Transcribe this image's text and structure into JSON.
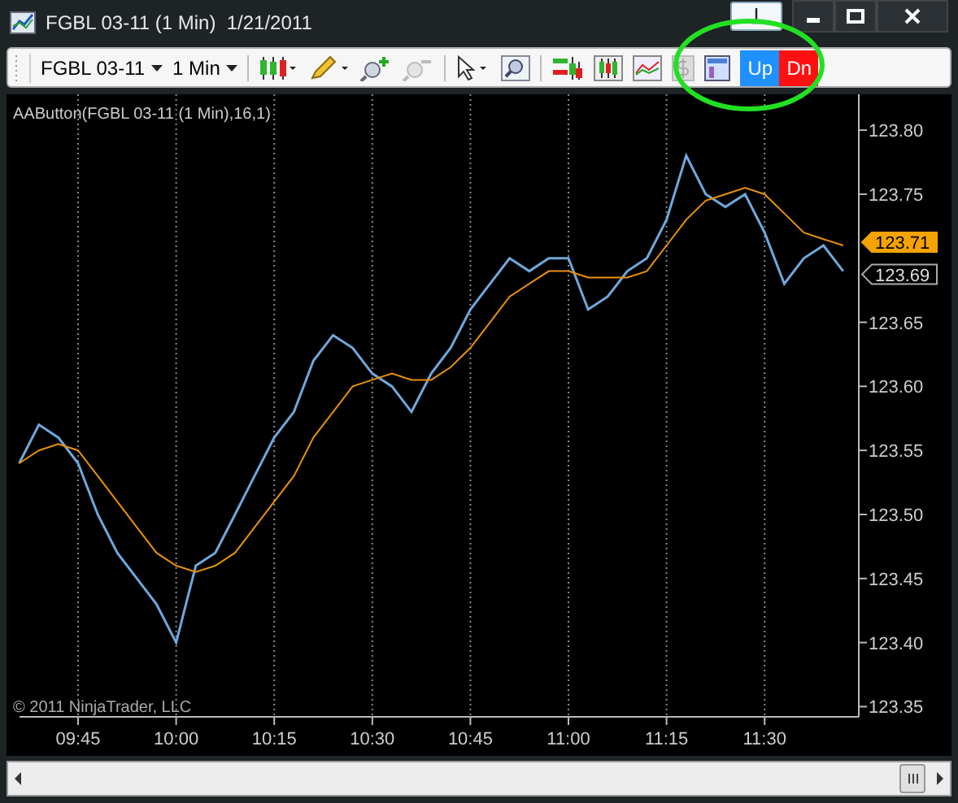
{
  "window": {
    "title": "FGBL 03-11 (1 Min)  1/21/2011"
  },
  "toolbar": {
    "instrument": "FGBL 03-11",
    "interval": "1 Min",
    "buttons": [
      {
        "label": "Up",
        "kind": "up"
      },
      {
        "label": "Dn",
        "kind": "down"
      }
    ]
  },
  "chart": {
    "copyright": "© 2011 NinjaTrader, LLC",
    "price_tags": [
      {
        "label": "123.71",
        "kind": "indicator"
      },
      {
        "label": "123.69",
        "kind": "last"
      }
    ],
    "chart_data": {
      "type": "line",
      "title": "AAButton(FGBL 03-11 (1 Min),16,1)",
      "categories": [
        null,
        null,
        null,
        "09:45",
        null,
        null,
        null,
        null,
        "10:00",
        null,
        null,
        null,
        null,
        "10:15",
        null,
        null,
        null,
        null,
        "10:30",
        null,
        null,
        null,
        null,
        "10:45",
        null,
        null,
        null,
        null,
        "11:00",
        null,
        null,
        null,
        null,
        "11:15",
        null,
        null,
        null,
        null,
        "11:30",
        null,
        null,
        null,
        null
      ],
      "series": [
        {
          "color": "#6fa8dc",
          "values": [
            123.54,
            123.57,
            123.56,
            123.54,
            123.5,
            123.47,
            123.45,
            123.43,
            123.4,
            123.46,
            123.47,
            123.5,
            123.53,
            123.56,
            123.58,
            123.62,
            123.64,
            123.63,
            123.61,
            123.6,
            123.58,
            123.61,
            123.63,
            123.66,
            123.68,
            123.7,
            123.69,
            123.7,
            123.7,
            123.66,
            123.67,
            123.69,
            123.7,
            123.73,
            123.78,
            123.75,
            123.74,
            123.75,
            123.72,
            123.68,
            123.7,
            123.71,
            123.69
          ]
        },
        {
          "color": "#e8900c",
          "values": [
            123.54,
            123.55,
            123.555,
            123.55,
            123.53,
            123.51,
            123.49,
            123.47,
            123.46,
            123.455,
            123.46,
            123.47,
            123.49,
            123.51,
            123.53,
            123.56,
            123.58,
            123.6,
            123.605,
            123.61,
            123.605,
            123.605,
            123.615,
            123.63,
            123.65,
            123.67,
            123.68,
            123.69,
            123.69,
            123.685,
            123.685,
            123.685,
            123.69,
            123.71,
            123.73,
            123.745,
            123.75,
            123.755,
            123.75,
            123.735,
            123.72,
            123.715,
            123.71
          ]
        }
      ],
      "grid": true,
      "ylim": [
        123.342,
        123.828
      ],
      "yticks": [
        {
          "value": 123.35,
          "label": "123.35"
        },
        {
          "value": 123.4,
          "label": "123.40"
        },
        {
          "value": 123.45,
          "label": "123.45"
        },
        {
          "value": 123.5,
          "label": "123.50"
        },
        {
          "value": 123.55,
          "label": "123.55"
        },
        {
          "value": 123.6,
          "label": "123.60"
        },
        {
          "value": 123.65,
          "label": "123.65"
        },
        {
          "value": 123.75,
          "label": "123.75"
        },
        {
          "value": 123.8,
          "label": "123.80"
        }
      ]
    }
  }
}
